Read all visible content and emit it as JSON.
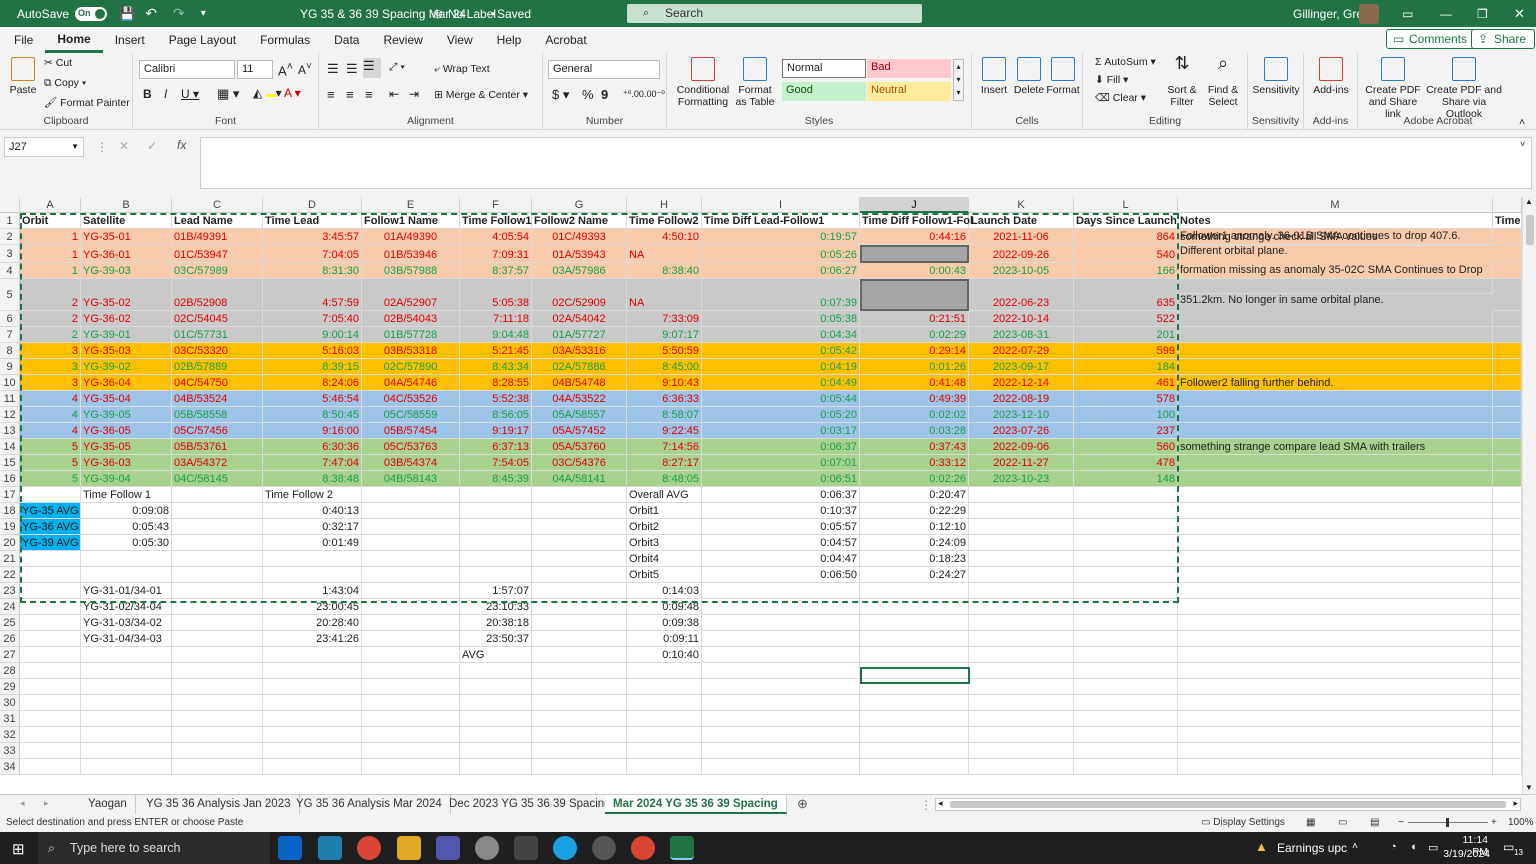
{
  "titlebar": {
    "autosave": "AutoSave",
    "autosave_state": "On",
    "doc_title": "YG 35 & 36 39 Spacing Mar 24",
    "label": "No Label",
    "saved": "Saved",
    "search": "Search",
    "user": "Gillinger, Greg"
  },
  "menu": [
    "File",
    "Home",
    "Insert",
    "Page Layout",
    "Formulas",
    "Data",
    "Review",
    "View",
    "Help",
    "Acrobat"
  ],
  "menu_active": "Home",
  "comments_button": "Comments",
  "share_button": "Share",
  "ribbon": {
    "paste": "Paste",
    "cut": "Cut",
    "copy": "Copy",
    "format_painter": "Format Painter",
    "clipboard": "Clipboard",
    "font_name": "Calibri",
    "font_size": "11",
    "font": "Font",
    "wrap_text": "Wrap Text",
    "merge_center": "Merge & Center",
    "alignment": "Alignment",
    "number_format": "General",
    "number": "Number",
    "conditional_formatting": "Conditional Formatting",
    "format_as_table": "Format as Table",
    "style_normal": "Normal",
    "style_bad": "Bad",
    "style_good": "Good",
    "style_neutral": "Neutral",
    "styles": "Styles",
    "insert": "Insert",
    "delete": "Delete",
    "format": "Format",
    "cells": "Cells",
    "autosum": "AutoSum",
    "fill": "Fill",
    "clear": "Clear",
    "sort_filter": "Sort & Filter",
    "find_select": "Find & Select",
    "editing": "Editing",
    "sensitivity": "Sensitivity",
    "add_ins": "Add-ins",
    "create_pdf_share_link": "Create PDF and Share link",
    "create_pdf_outlook": "Create PDF and Share via Outlook",
    "adobe_acrobat": "Adobe Acrobat"
  },
  "name_box": "J27",
  "columns": [
    "A",
    "B",
    "C",
    "D",
    "E",
    "F",
    "G",
    "H",
    "I",
    "J",
    "K",
    "L",
    "M"
  ],
  "selected_column": "J",
  "headers": {
    "a": "Orbit",
    "b": "Satellite",
    "c": "Lead Name",
    "d": "Time Lead",
    "e": "Follow1 Name",
    "f": "Time Follow1",
    "g": "Follow2 Name",
    "h": "Time Follow2",
    "i": "Time Diff Lead-Follow1",
    "j": "Time Diff Follow1-Fol",
    "k": "Launch Date",
    "l": "Days Since Launch",
    "m": "Notes",
    "n": "Time"
  },
  "data_rows": [
    {
      "row": "2",
      "orbit": "1",
      "sat": "YG-35-01",
      "lead": "01B/49391",
      "tlead": "3:45:57",
      "f1": "01A/49390",
      "tf1": "4:05:54",
      "f2": "01C/49393",
      "tf2": "4:50:10",
      "dlf": "0:19:57",
      "dff": "0:44:16",
      "launch": "2021-11-06",
      "days": "864",
      "note": "something strange check all SMA values"
    },
    {
      "row": "3",
      "orbit": "1",
      "sat": "YG-36-01",
      "lead": "01C/53947",
      "tlead": "7:04:05",
      "f1": "01B/53946",
      "tf1": "7:09:31",
      "f2": "01A/53943",
      "tf2": "NA",
      "dlf": "0:05:26",
      "dff": "",
      "launch": "2022-09-26",
      "days": "540",
      "note": "Follower1 anomaly.  36-01B SMA continues to drop 407.6.",
      "note2": "Different orbital plane."
    },
    {
      "row": "4",
      "orbit": "1",
      "sat": "YG-39-03",
      "lead": "03C/57989",
      "tlead": "8:31:30",
      "f1": "03B/57988",
      "tf1": "8:37:57",
      "f2": "03A/57986",
      "tf2": "8:38:40",
      "dlf": "0:06:27",
      "dff": "0:00:43",
      "launch": "2023-10-05",
      "days": "166",
      "note": ""
    },
    {
      "row": "5",
      "orbit": "2",
      "sat": "YG-35-02",
      "lead": "02B/52908",
      "tlead": "4:57:59",
      "f1": "02A/52907",
      "tf1": "5:05:38",
      "f2": "02C/52909",
      "tf2": "NA",
      "dlf": "0:07:39",
      "dff": "",
      "launch": "2022-06-23",
      "days": "635",
      "note": "formation missing as anomaly 35-02C SMA Continues to Drop",
      "note2": "351.2km.  No longer in same orbital plane."
    },
    {
      "row": "6",
      "orbit": "2",
      "sat": "YG-36-02",
      "lead": "02C/54045",
      "tlead": "7:05:40",
      "f1": "02B/54043",
      "tf1": "7:11:18",
      "f2": "02A/54042",
      "tf2": "7:33:09",
      "dlf": "0:05:38",
      "dff": "0:21:51",
      "launch": "2022-10-14",
      "days": "522",
      "note": ""
    },
    {
      "row": "7",
      "orbit": "2",
      "sat": "YG-39-01",
      "lead": "01C/57731",
      "tlead": "9:00:14",
      "f1": "01B/57728",
      "tf1": "9:04:48",
      "f2": "01A/57727",
      "tf2": "9:07:17",
      "dlf": "0:04:34",
      "dff": "0:02:29",
      "launch": "2023-08-31",
      "days": "201",
      "note": ""
    },
    {
      "row": "8",
      "orbit": "3",
      "sat": "YG-35-03",
      "lead": "03C/53320",
      "tlead": "5:16:03",
      "f1": "03B/53318",
      "tf1": "5:21:45",
      "f2": "03A/53316",
      "tf2": "5:50:59",
      "dlf": "0:05:42",
      "dff": "0:29:14",
      "launch": "2022-07-29",
      "days": "599",
      "note": ""
    },
    {
      "row": "9",
      "orbit": "3",
      "sat": "YG-39-02",
      "lead": "02B/57889",
      "tlead": "8:39:15",
      "f1": "02C/57890",
      "tf1": "8:43:34",
      "f2": "02A/57886",
      "tf2": "8:45:00",
      "dlf": "0:04:19",
      "dff": "0:01:26",
      "launch": "2023-09-17",
      "days": "184",
      "note": ""
    },
    {
      "row": "10",
      "orbit": "3",
      "sat": "YG-36-04",
      "lead": "04C/54750",
      "tlead": "8:24:06",
      "f1": "04A/54746",
      "tf1": "8:28:55",
      "f2": "04B/54748",
      "tf2": "9:10:43",
      "dlf": "0:04:49",
      "dff": "0:41:48",
      "launch": "2022-12-14",
      "days": "461",
      "note": "Follower2 falling further behind."
    },
    {
      "row": "11",
      "orbit": "4",
      "sat": "YG-35-04",
      "lead": "04B/53524",
      "tlead": "5:46:54",
      "f1": "04C/53526",
      "tf1": "5:52:38",
      "f2": "04A/53522",
      "tf2": "6:36:33",
      "dlf": "0:05:44",
      "dff": "0:49:39",
      "launch": "2022-08-19",
      "days": "578",
      "note": ""
    },
    {
      "row": "12",
      "orbit": "4",
      "sat": "YG-39-05",
      "lead": "05B/58558",
      "tlead": "8:50:45",
      "f1": "05C/58559",
      "tf1": "8:56:05",
      "f2": "05A/58557",
      "tf2": "8:58:07",
      "dlf": "0:05:20",
      "dff": "0:02:02",
      "launch": "2023-12-10",
      "days": "100",
      "note": ""
    },
    {
      "row": "13",
      "orbit": "4",
      "sat": "YG-36-05",
      "lead": "05C/57456",
      "tlead": "9:16:00",
      "f1": "05B/57454",
      "tf1": "9:19:17",
      "f2": "05A/57452",
      "tf2": "9:22:45",
      "dlf": "0:03:17",
      "dff": "0:03:28",
      "launch": "2023-07-26",
      "days": "237",
      "note": ""
    },
    {
      "row": "14",
      "orbit": "5",
      "sat": "YG-35-05",
      "lead": "05B/53761",
      "tlead": "6:30:36",
      "f1": "05C/53763",
      "tf1": "6:37:13",
      "f2": "05A/53760",
      "tf2": "7:14:56",
      "dlf": "0:06:37",
      "dff": "0:37:43",
      "launch": "2022-09-06",
      "days": "560",
      "note": "something strange compare lead SMA with trailers"
    },
    {
      "row": "15",
      "orbit": "5",
      "sat": "YG-36-03",
      "lead": "03A/54372",
      "tlead": "7:47:04",
      "f1": "03B/54374",
      "tf1": "7:54:05",
      "f2": "03C/54376",
      "tf2": "8:27:17",
      "dlf": "0:07:01",
      "dff": "0:33:12",
      "launch": "2022-11-27",
      "days": "478",
      "note": ""
    },
    {
      "row": "16",
      "orbit": "5",
      "sat": "YG-39-04",
      "lead": "04C/58145",
      "tlead": "8:38:48",
      "f1": "04B/58143",
      "tf1": "8:45:39",
      "f2": "04A/58141",
      "tf2": "8:48:05",
      "dlf": "0:06:51",
      "dff": "0:02:26",
      "launch": "2023-10-23",
      "days": "148",
      "note": ""
    }
  ],
  "summary": {
    "r17": {
      "b": "Time Follow 1",
      "d": "Time Follow 2",
      "h": "Overall AVG",
      "i": "0:06:37",
      "j": "0:20:47"
    },
    "r18": {
      "a": "YG-35 AVG",
      "b": "0:09:08",
      "d": "0:40:13",
      "h": "Orbit1",
      "i": "0:10:37",
      "j": "0:22:29"
    },
    "r19": {
      "a": "YG-36 AVG",
      "b": "0:05:43",
      "d": "0:32:17",
      "h": "Orbit2",
      "i": "0:05:57",
      "j": "0:12:10"
    },
    "r20": {
      "a": "YG-39 AVG",
      "b": "0:05:30",
      "d": "0:01:49",
      "h": "Orbit3",
      "i": "0:04:57",
      "j": "0:24:09"
    },
    "r21": {
      "h": "Orbit4",
      "i": "0:04:47",
      "j": "0:18:23"
    },
    "r22": {
      "h": "Orbit5",
      "i": "0:06:50",
      "j": "0:24:27"
    },
    "r23": {
      "b": "YG-31-01/34-01",
      "d": "1:43:04",
      "f": "1:57:07",
      "h": "0:14:03"
    },
    "r24": {
      "b": "YG-31-02/34-04",
      "d": "23:00:45",
      "f": "23:10:33",
      "h": "0:09:48"
    },
    "r25": {
      "b": "YG-31-03/34-02",
      "d": "20:28:40",
      "f": "20:38:18",
      "h": "0:09:38"
    },
    "r26": {
      "b": "YG-31-04/34-03",
      "d": "23:41:26",
      "f": "23:50:37",
      "h": "0:09:11"
    },
    "r27": {
      "f": "AVG",
      "h": "0:10:40"
    }
  },
  "empty_rows": [
    "28",
    "29",
    "30",
    "31",
    "32",
    "33",
    "34"
  ],
  "sheet_tabs": [
    "Yaogan",
    "YG 35 36 Analysis Jan 2023",
    "YG 35 36 Analysis Mar 2024",
    "Dec 2023 YG 35 36 39 Spacing",
    "Mar 2024 YG 35 36 39 Spacing"
  ],
  "active_tab": "Mar 2024 YG 35 36 39 Spacing",
  "status": {
    "message": "Select destination and press ENTER or choose Paste",
    "display_settings": "Display Settings",
    "zoom": "100%"
  },
  "taskbar": {
    "search": "Type here to search",
    "news": "Earnings upc",
    "time": "11:14 PM",
    "date": "3/19/2024",
    "notif": "13"
  },
  "colors": {
    "excel_green": "#217346",
    "orbit1": "#f8cbad",
    "orbit2": "#c9c9c9",
    "orbit3": "#ffc000",
    "orbit4": "#9dc3e6",
    "orbit5": "#a9d18e",
    "avg_label": "#00b0f0"
  }
}
